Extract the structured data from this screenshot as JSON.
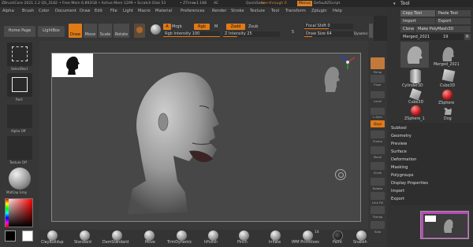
{
  "titlebar": {
    "app": "ZBrushCore 2021.1.2 QS_3182",
    "free_mem": "• Free Mem 6.892GB • Active Mem 1299 • Scratch Disk 53",
    "ztime": "• ZTime▸1.188",
    "ac": "AC",
    "quicksave": "QuickSave",
    "see_through": "See-through 0",
    "menus": "Menus",
    "script": "DefaultZScript"
  },
  "menubar": [
    "Alpha",
    "Brush",
    "Color",
    "Document",
    "Draw",
    "Edit",
    "File",
    "Light",
    "Macro",
    "Material",
    "Preferences",
    "Render",
    "Stroke",
    "Texture",
    "Tool",
    "Transform",
    "Zplugin",
    "Help"
  ],
  "shelf": {
    "home_page": "Home Page",
    "lightbox": "LightBox",
    "draw": "Draw",
    "move": "Move",
    "scale": "Scale",
    "rotate": "Rotate",
    "a": "A",
    "mrgb": "Mrgb",
    "rgb": "Rgb",
    "m": "M",
    "zadd": "Zadd",
    "zsub": "Zsub",
    "rgb_intensity": "Rgb Intensity 100",
    "z_intensity": "Z Intensity 25",
    "focal_shift": "Focal Shift 0",
    "draw_size": "Draw Size 64",
    "dynamic": "Dynamic",
    "brush_count": "5"
  },
  "left": {
    "select_rect": "SelectRect",
    "rect": "Rect",
    "alpha_off": "Alpha Off",
    "texture_off": "Texture Off",
    "matcap": "MatCap Gray"
  },
  "rightstrip": [
    "Persp",
    "Floor",
    "Local",
    "L.Sym",
    "Qxyz",
    "Frame",
    "Move",
    "Scale",
    "Rotate",
    "Line Fill",
    "Transp",
    "Solo"
  ],
  "tool_panel": {
    "title": "Tool",
    "copy_tool": "Copy Tool",
    "paste_tool": "Paste Tool",
    "import": "Import",
    "export": "Export",
    "clone": "Clone",
    "make_polymesh": "Make PolyMesh3D",
    "current_tool": "Merged_2021",
    "count": "19",
    "r_label": "R",
    "thumbs": [
      "Merged_2021",
      "Cylinder3D",
      "Cube3D",
      "Cube3D",
      "ZSphere",
      "ZSphere_1",
      "Dog"
    ],
    "sections": [
      "Subtool",
      "Geometry",
      "Preview",
      "Surface",
      "Deformation",
      "Masking",
      "Polygroups",
      "Display Properties",
      "Import",
      "Export"
    ]
  },
  "brushes": [
    "ClayBuildup",
    "Standard",
    "DamStandard",
    "Move",
    "TrimDynamic",
    "hPolish",
    "Pinch",
    "Inflate",
    "IMM Primitives",
    "Paint",
    "Snakeh"
  ],
  "brush_badge": "14",
  "colors": {
    "accent": "#e07a16",
    "panel": "#323232",
    "canvas": "#474747"
  }
}
